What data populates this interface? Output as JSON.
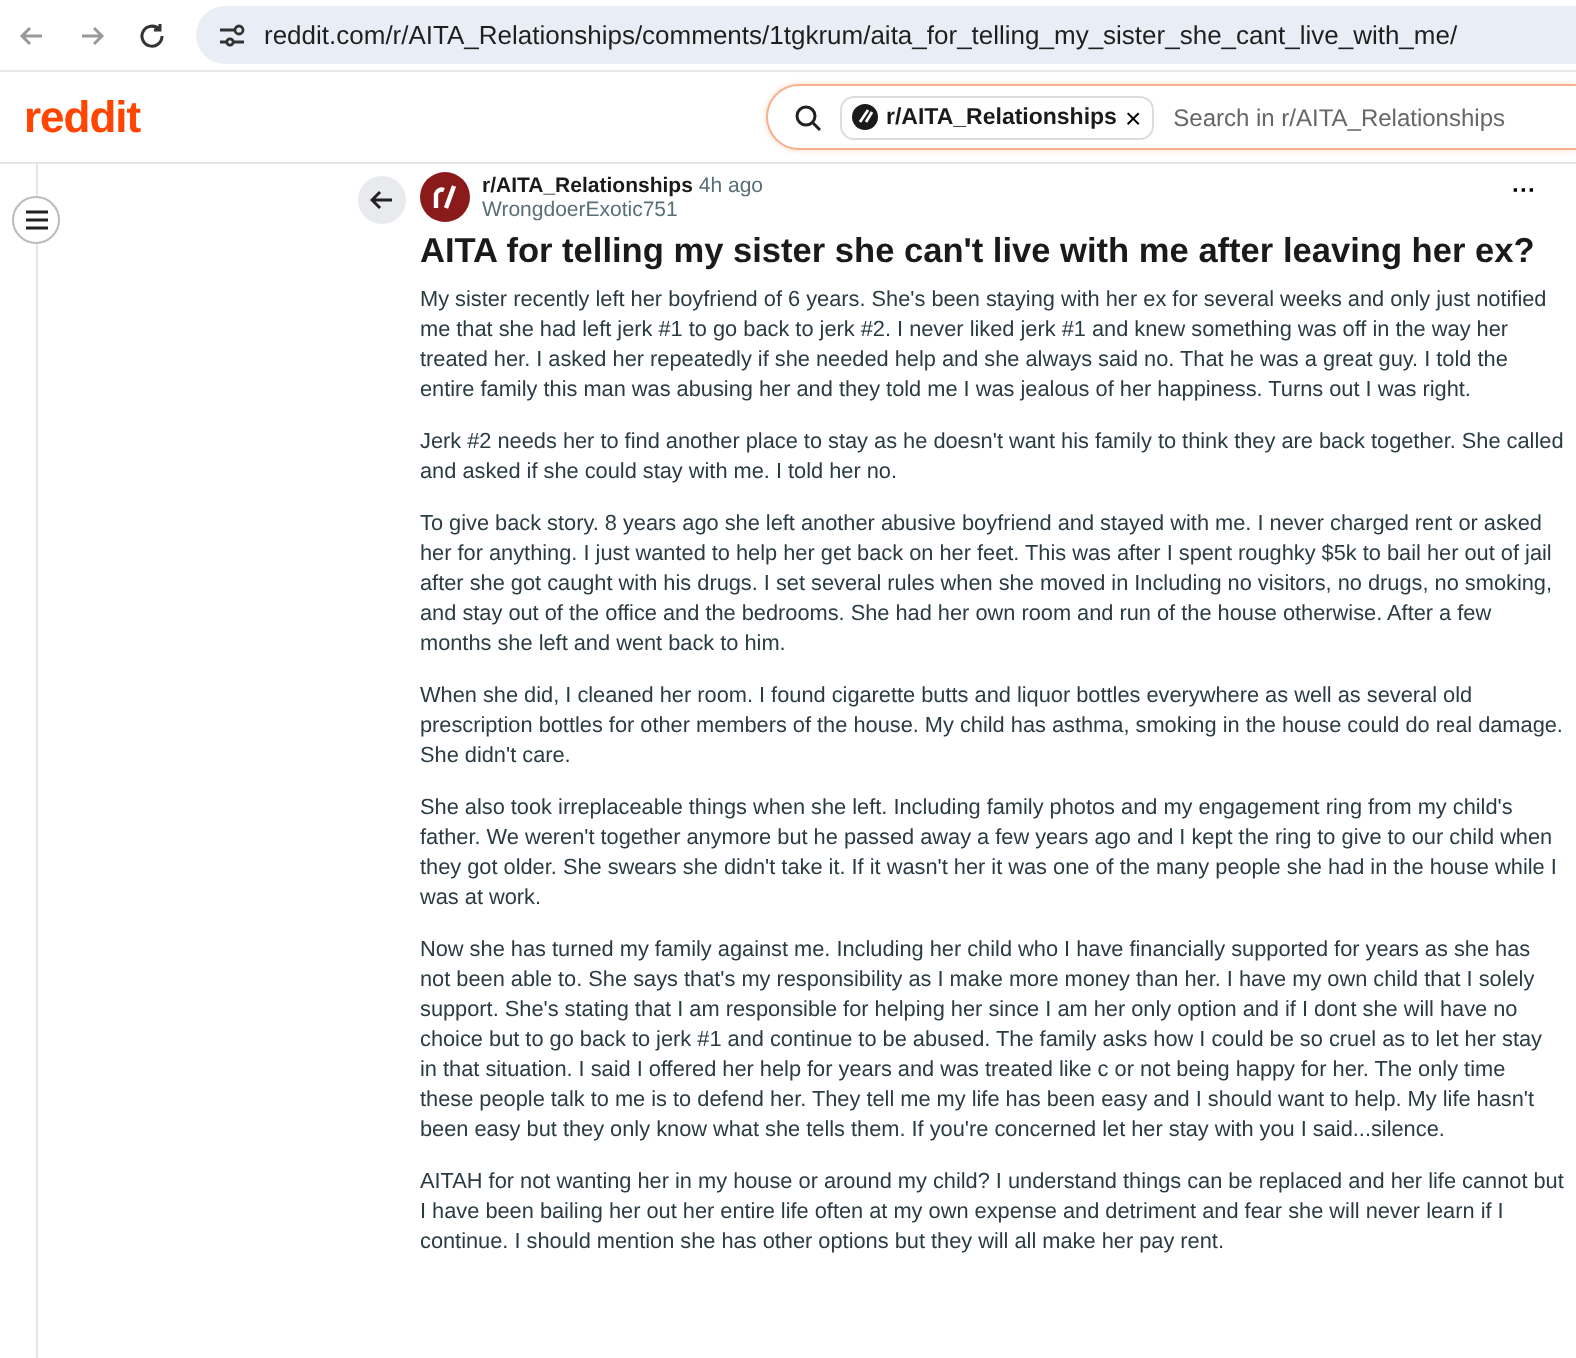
{
  "browser": {
    "url": "reddit.com/r/AITA_Relationships/comments/1tgkrum/aita_for_telling_my_sister_she_cant_live_with_me/"
  },
  "header": {
    "logo": "reddit",
    "search": {
      "chip": "r/AITA_Relationships",
      "chip_close": "×",
      "placeholder": "Search in r/AITA_Relationships"
    }
  },
  "post": {
    "subreddit": "r/AITA_Relationships",
    "time": "4h ago",
    "author": "WrongdoerExotic751",
    "more": "···",
    "title": "AITA for telling my sister she can't live with me after leaving her ex?",
    "paragraphs": [
      "My sister recently left her boyfriend of 6 years. She's been staying with her ex for several weeks and only just notified me that she had left jerk #1 to go back to jerk #2. I never liked jerk #1 and knew something was off in the way her treated her. I asked her repeatedly if she needed help and she always said no. That he was a great guy. I told the entire family this man was abusing her and they told me I was jealous of her happiness. Turns out I was right.",
      "Jerk #2 needs her to find another place to stay as he doesn't want his family to think they are back together. She called and asked if she could stay with me. I told her no.",
      "To give back story. 8 years ago she left another abusive boyfriend and stayed with me. I never charged rent or asked her for anything. I just wanted to help her get back on her feet. This was after I spent roughky $5k to bail her out of jail after she got caught with his drugs. I set several rules when she moved in Including no visitors, no drugs, no smoking, and stay out of the office and the bedrooms. She had her own room and run of the house otherwise. After a few months she left and went back to him.",
      "When she did, I cleaned her room. I found cigarette butts and liquor bottles everywhere as well as several old prescription bottles for other members of the house. My child has asthma, smoking in the house could do real damage. She didn't care.",
      "She also took irreplaceable things when she left. Including family photos and my engagement ring from my child's father. We weren't together anymore but he passed away a few years ago and I kept the ring to give to our child when they got older. She swears she didn't take it. If it wasn't her it was one of the many people she had in the house while I was at work.",
      "Now she has turned my family against me. Including her child who I have financially supported for years as she has not been able to. She says that's my responsibility as I make more money than her. I have my own child that I solely support. She's stating that I am responsible for helping her since I am her only option and if I dont she will have no choice but to go back to jerk #1 and continue to be abused. The family asks how I could be so cruel as to let her stay in that situation. I said I offered her help for years and was treated like c or not being happy for her. The only time these people talk to me is to defend her. They tell me my life has been easy and I should want to help. My life hasn't been easy but they only know what she tells them. If you're concerned let her stay with you I said...silence.",
      "AITAH for not wanting her in my house or around my child? I understand things can be replaced and her life cannot but I have been bailing her out her entire life often at my own expense and detriment and fear she will never learn if I continue. I should mention she has other options but they will all make her pay rent."
    ]
  }
}
